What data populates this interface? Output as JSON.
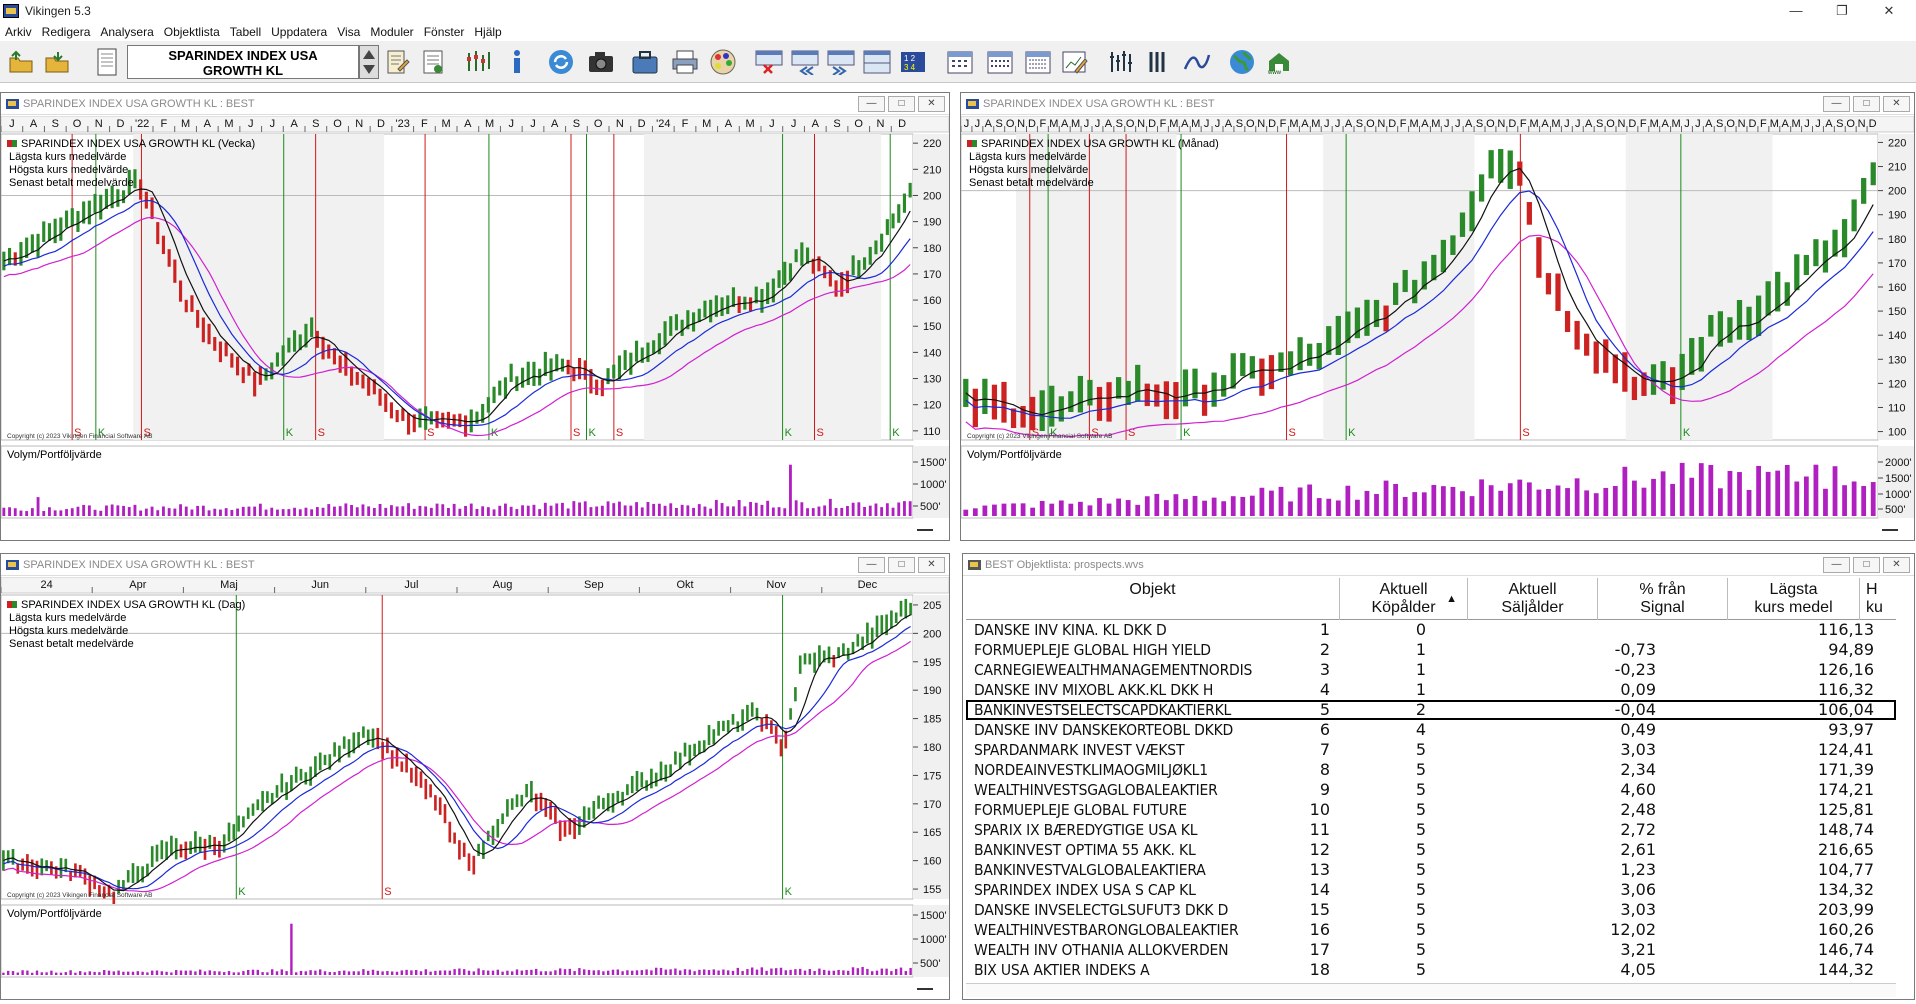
{
  "app": {
    "title": "Vikingen 5.3"
  },
  "menu": [
    "Arkiv",
    "Redigera",
    "Analysera",
    "Objektlista",
    "Tabell",
    "Uppdatera",
    "Visa",
    "Moduler",
    "Fönster",
    "Hjälp"
  ],
  "toolbar": {
    "object_line1": "SPARINDEX INDEX USA",
    "object_line2": "GROWTH KL"
  },
  "win_weekly": {
    "title": "SPARINDEX INDEX USA GROWTH KL : BEST"
  },
  "win_monthly": {
    "title": "SPARINDEX INDEX USA GROWTH KL : BEST"
  },
  "win_daily": {
    "title": "SPARINDEX INDEX USA GROWTH KL : BEST"
  },
  "win_list": {
    "title": "BEST Objektlista: prospects.wvs"
  },
  "legend": {
    "lagsta": "Lägsta kurs medelvärde",
    "hogsta": "Högsta kurs medelvärde",
    "senast": "Senast betalt medelvärde",
    "volym": "Volym/Portföljvärde",
    "copyright": "Copyright (c) 2023 Vikingen Financial Software AB"
  },
  "chart_data": [
    {
      "id": "weekly",
      "type": "bar",
      "title": "SPARINDEX INDEX USA GROWTH KL (Vecka)",
      "y_ticks": [
        220,
        210,
        200,
        190,
        180,
        170,
        160,
        150,
        140,
        130,
        120,
        110
      ],
      "vol_ticks": [
        "1500'",
        "1000'",
        "500'"
      ],
      "x_labels": [
        "J",
        "A",
        "S",
        "O",
        "N",
        "D",
        "'22",
        "F",
        "M",
        "A",
        "M",
        "J",
        "J",
        "A",
        "S",
        "O",
        "N",
        "D",
        "'23",
        "F",
        "M",
        "A",
        "M",
        "J",
        "J",
        "A",
        "S",
        "O",
        "N",
        "D",
        "'24",
        "F",
        "M",
        "A",
        "M",
        "J",
        "J",
        "A",
        "S",
        "O",
        "N",
        "D"
      ],
      "signals": [
        "S",
        "K",
        "S",
        "K",
        "S",
        "S",
        "K",
        "S",
        "K",
        "S",
        "K",
        "S",
        "K"
      ]
    },
    {
      "id": "monthly",
      "type": "bar",
      "title": "SPARINDEX INDEX USA GROWTH KL (Månad)",
      "y_ticks": [
        220,
        210,
        200,
        190,
        180,
        170,
        160,
        150,
        140,
        130,
        120,
        110,
        100
      ],
      "vol_ticks": [
        "2000'",
        "1500'",
        "1000'",
        "500'"
      ],
      "x_labels": [
        "J",
        "J",
        "A",
        "S",
        "O",
        "N",
        "D",
        "F",
        "M",
        "A",
        "M",
        "J",
        "J",
        "A",
        "S",
        "O",
        "N",
        "D",
        "F",
        "M",
        "A",
        "M",
        "J",
        "J",
        "A",
        "S",
        "O",
        "N",
        "D",
        "F",
        "M",
        "A",
        "M",
        "J",
        "J",
        "A",
        "S",
        "O",
        "N",
        "D",
        "F",
        "M",
        "A",
        "M",
        "J",
        "J",
        "A",
        "S",
        "O",
        "N",
        "D",
        "F",
        "M",
        "A",
        "M",
        "J",
        "J",
        "A",
        "S",
        "O",
        "N",
        "D",
        "F",
        "M",
        "A",
        "M",
        "J",
        "J",
        "A",
        "S",
        "O",
        "N",
        "D",
        "F",
        "M",
        "A",
        "M",
        "J",
        "J",
        "A",
        "S",
        "O",
        "N",
        "D"
      ],
      "signals": [
        "S",
        "K",
        "S",
        "S",
        "K",
        "S",
        "K",
        "S",
        "K"
      ]
    },
    {
      "id": "daily",
      "type": "bar",
      "title": "SPARINDEX INDEX USA GROWTH KL (Dag)",
      "y_ticks": [
        205,
        200,
        195,
        190,
        185,
        180,
        175,
        170,
        165,
        160,
        155
      ],
      "vol_ticks": [
        "1500'",
        "1000'",
        "500'"
      ],
      "x_labels": [
        "24",
        "Apr",
        "Maj",
        "Jun",
        "Jul",
        "Aug",
        "Sep",
        "Okt",
        "Nov",
        "Dec"
      ],
      "signals": [
        "K",
        "S",
        "K"
      ]
    }
  ],
  "table": {
    "headers": {
      "objekt": "Objekt",
      "kop1": "Aktuell",
      "kop2": "Köpålder",
      "salj1": "Aktuell",
      "salj2": "Säljålder",
      "proc1": "% från",
      "proc2": "Signal",
      "lagst1": "Lägsta",
      "lagst2": "kurs medel",
      "extra1": "H",
      "extra2": "ku"
    },
    "rows": [
      {
        "name": "DANSKE INV KINA. KL DKK D",
        "num": "1",
        "kop": "0",
        "proc": "",
        "lagst": "116,13"
      },
      {
        "name": "FORMUEPLEJE GLOBAL HIGH YIELD",
        "num": "2",
        "kop": "1",
        "proc": "-0,73",
        "lagst": "94,89"
      },
      {
        "name": "CARNEGIEWEALTHMANAGEMENTNORDIS",
        "num": "3",
        "kop": "1",
        "proc": "-0,23",
        "lagst": "126,16"
      },
      {
        "name": "DANSKE INV MIXOBL AKK.KL DKK H",
        "num": "4",
        "kop": "1",
        "proc": "0,09",
        "lagst": "116,32"
      },
      {
        "name": "BANKINVESTSELECTSCAPDKAKTIERKL",
        "num": "5",
        "kop": "2",
        "proc": "-0,04",
        "lagst": "106,04",
        "selected": true
      },
      {
        "name": "DANSKE INV DANSKEKORTEOBL DKKD",
        "num": "6",
        "kop": "4",
        "proc": "0,49",
        "lagst": "93,97"
      },
      {
        "name": "SPARDANMARK INVEST VÆKST",
        "num": "7",
        "kop": "5",
        "proc": "3,03",
        "lagst": "124,41"
      },
      {
        "name": "NORDEAINVESTKLIMAOGMILJØKL1",
        "num": "8",
        "kop": "5",
        "proc": "2,34",
        "lagst": "171,39"
      },
      {
        "name": "WEALTHINVESTSGAGLOBALEAKTIER",
        "num": "9",
        "kop": "5",
        "proc": "4,60",
        "lagst": "174,21"
      },
      {
        "name": "FORMUEPLEJE GLOBAL FUTURE",
        "num": "10",
        "kop": "5",
        "proc": "2,48",
        "lagst": "125,81"
      },
      {
        "name": "SPARIX IX BÆREDYGTIGE USA KL",
        "num": "11",
        "kop": "5",
        "proc": "2,72",
        "lagst": "148,74"
      },
      {
        "name": "BANKINVEST OPTIMA 55 AKK. KL",
        "num": "12",
        "kop": "5",
        "proc": "2,61",
        "lagst": "216,65"
      },
      {
        "name": "BANKINVESTVALGLOBALEAKTIERA",
        "num": "13",
        "kop": "5",
        "proc": "1,23",
        "lagst": "104,77"
      },
      {
        "name": "SPARINDEX INDEX USA S CAP KL",
        "num": "14",
        "kop": "5",
        "proc": "3,06",
        "lagst": "134,32"
      },
      {
        "name": "DANSKE INVSELECTGLSUFUT3 DKK D",
        "num": "15",
        "kop": "5",
        "proc": "3,03",
        "lagst": "203,99"
      },
      {
        "name": "WEALTHINVESTBARONGLOBALEAKTIER",
        "num": "16",
        "kop": "5",
        "proc": "12,02",
        "lagst": "160,26"
      },
      {
        "name": "WEALTH INV OTHANIA ALLOKVERDEN",
        "num": "17",
        "kop": "5",
        "proc": "3,21",
        "lagst": "146,74"
      },
      {
        "name": "BIX USA AKTIER INDEKS A",
        "num": "18",
        "kop": "5",
        "proc": "4,05",
        "lagst": "144,32"
      }
    ]
  }
}
